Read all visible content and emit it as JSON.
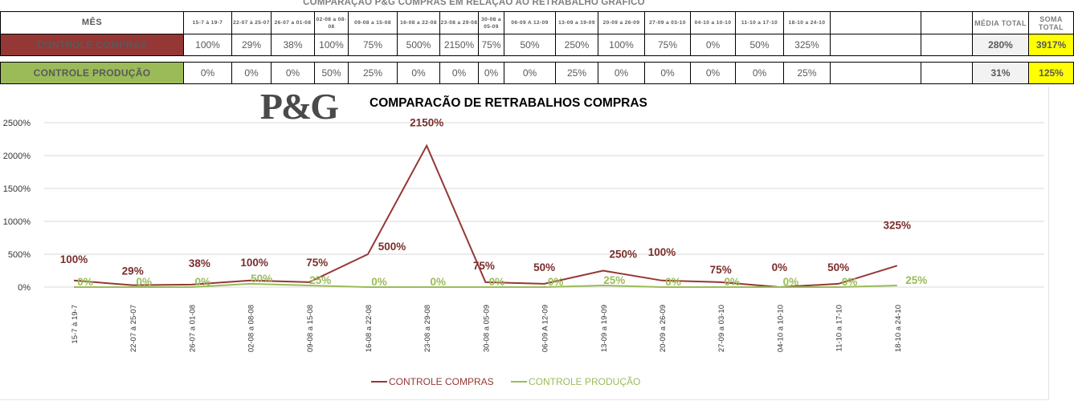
{
  "sheet_title": "COMPARAÇÃO P&G  COMPRAS EM RELAÇÃO AO RETRABALHO GRÁFICO",
  "table": {
    "month_header": "MÊS",
    "period_headers": [
      "15-7 à 19-7",
      "22-07 à 25-07",
      "26-07 a 01-08",
      "02-08 a 08-08",
      "09-08 a 15-08",
      "16-08 a 22-08",
      "23-08 a 29-08",
      "30-08 a 05-09",
      "06-09 A 12-09",
      "13-09 a 19-09",
      "20-09 a 26-09",
      "27-09 a 03-10",
      "04-10 a 10-10",
      "11-10 a 17-10",
      "18-10 a 24-10",
      ""
    ],
    "media_header": "MÉDIA TOTAL",
    "soma_header": "SOMA TOTAL",
    "rows": [
      {
        "label": "CONTROLE COMPRAS",
        "values": [
          "100%",
          "29%",
          "38%",
          "100%",
          "75%",
          "500%",
          "2150%",
          "75%",
          "50%",
          "250%",
          "100%",
          "75%",
          "0%",
          "50%",
          "325%",
          ""
        ],
        "media": "280%",
        "soma": "3917%"
      },
      {
        "label": "CONTROLE PRODUÇÃO",
        "values": [
          "0%",
          "0%",
          "0%",
          "50%",
          "25%",
          "0%",
          "0%",
          "0%",
          "0%",
          "25%",
          "0%",
          "0%",
          "0%",
          "0%",
          "25%",
          ""
        ],
        "media": "31%",
        "soma": "125%"
      }
    ]
  },
  "logo_text": "P&G",
  "chart_data": {
    "type": "line",
    "title": "COMPARACÃO DE RETRABALHOS  COMPRAS",
    "categories": [
      "15-7 à 19-7",
      "22-07 à 25-07",
      "26-07 a 01-08",
      "02-08 a 08-08",
      "09-08 a 15-08",
      "16-08 a 22-08",
      "23-08 a 29-08",
      "30-08 a 05-09",
      "06-09 A 12-09",
      "13-09 a 19-09",
      "20-09 a 26-09",
      "27-09 a 03-10",
      "04-10 a 10-10",
      "11-10 a 17-10",
      "18-10 a 24-10"
    ],
    "series": [
      {
        "name": "CONTROLE COMPRAS",
        "color": "#953735",
        "values": [
          100,
          29,
          38,
          100,
          75,
          500,
          2150,
          75,
          50,
          250,
          100,
          75,
          0,
          50,
          325
        ],
        "labels": [
          "100%",
          "29%",
          "38%",
          "100%",
          "75%",
          "500%",
          "2150%",
          "75%",
          "50%",
          "250%",
          "100%",
          "75%",
          "0%",
          "50%",
          "325%"
        ]
      },
      {
        "name": "CONTROLE PRODUÇÃO",
        "color": "#9bbb59",
        "values": [
          0,
          0,
          0,
          50,
          25,
          0,
          0,
          0,
          0,
          25,
          0,
          0,
          0,
          0,
          25
        ],
        "labels": [
          "0%",
          "0%",
          "0%",
          "50%",
          "25%",
          "0%",
          "0%",
          "0%",
          "0%",
          "25%",
          "0%",
          "0%",
          "0%",
          "0%",
          "25%"
        ]
      }
    ],
    "ylim": [
      0,
      2500
    ],
    "yticks": [
      "0%",
      "500%",
      "1000%",
      "1500%",
      "2000%",
      "2500%"
    ],
    "grid": true,
    "legend": "bottom"
  }
}
